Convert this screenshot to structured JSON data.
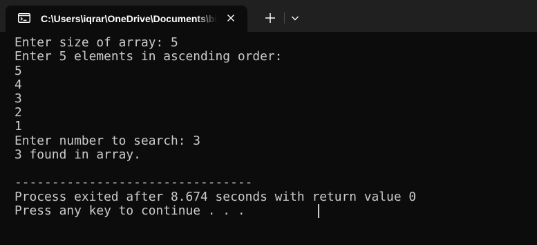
{
  "tab": {
    "icon": "terminal-icon",
    "title": "C:\\Users\\iqrar\\OneDrive\\Documents\\binary_search.exe",
    "close_icon": "close-icon"
  },
  "toolbar": {
    "new_tab_icon": "plus-icon",
    "dropdown_icon": "chevron-down-icon"
  },
  "console": {
    "lines": [
      "Enter size of array: 5",
      "Enter 5 elements in ascending order:",
      "5",
      "4",
      "3",
      "2",
      "1",
      "Enter number to search: 3",
      "3 found in array.",
      "",
      "--------------------------------",
      "Process exited after 8.674 seconds with return value 0",
      "Press any key to continue . . . "
    ]
  },
  "colors": {
    "background": "#0c0c0c",
    "titlebar": "#202020",
    "text": "#cccccc",
    "tab_text": "#ffffff"
  }
}
